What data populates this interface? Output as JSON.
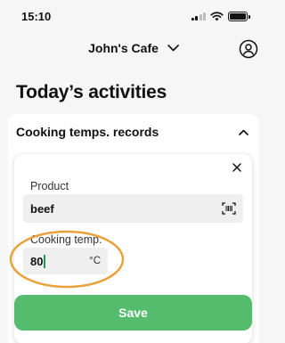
{
  "status_bar": {
    "time": "15:10"
  },
  "header": {
    "store_name": "John's Cafe"
  },
  "page": {
    "title": "Today’s activities"
  },
  "activity_card": {
    "title": "Cooking temps. records",
    "form": {
      "product_label": "Product",
      "product_value": "beef",
      "temp_label": "Cooking temp.",
      "temp_value": "80",
      "temp_unit": "°C",
      "save_label": "Save"
    }
  },
  "colors": {
    "save_button": "#55bc6e",
    "highlight_ring": "#e9a23b",
    "text_caret": "#1d9a52"
  },
  "icons": {
    "store_dropdown": "chevron-down-icon",
    "profile": "user-circle-icon",
    "collapse": "chevron-up-icon",
    "close": "close-icon",
    "barcode": "barcode-scan-icon"
  }
}
